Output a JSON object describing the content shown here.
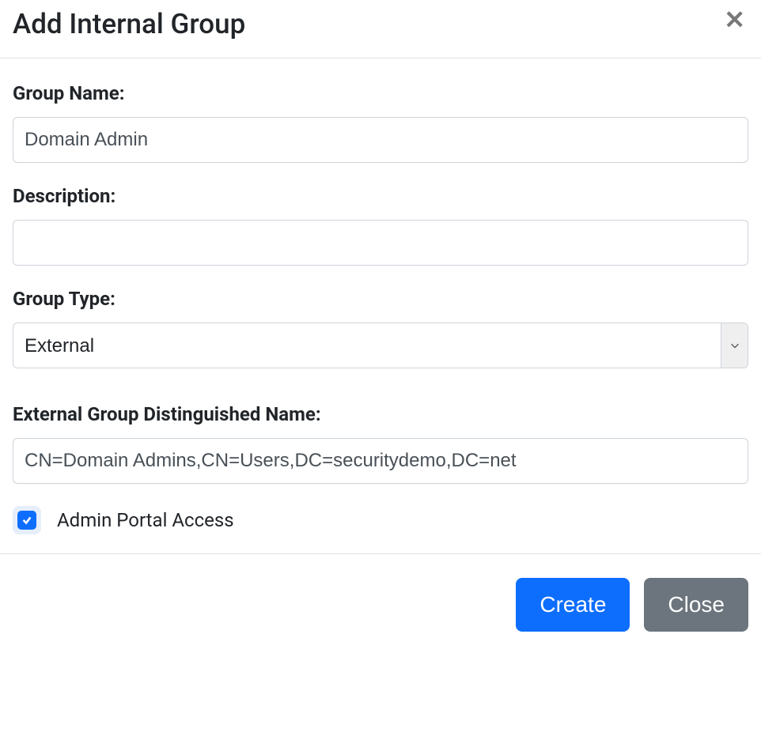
{
  "header": {
    "title": "Add Internal Group"
  },
  "form": {
    "group_name": {
      "label": "Group Name:",
      "value": "Domain Admin"
    },
    "description": {
      "label": "Description:",
      "value": ""
    },
    "group_type": {
      "label": "Group Type:",
      "selected": "External"
    },
    "dn": {
      "label": "External Group Distinguished Name:",
      "value": "CN=Domain Admins,CN=Users,DC=securitydemo,DC=net"
    },
    "admin_portal": {
      "label": "Admin Portal Access",
      "checked": true
    }
  },
  "footer": {
    "create_label": "Create",
    "close_label": "Close"
  }
}
